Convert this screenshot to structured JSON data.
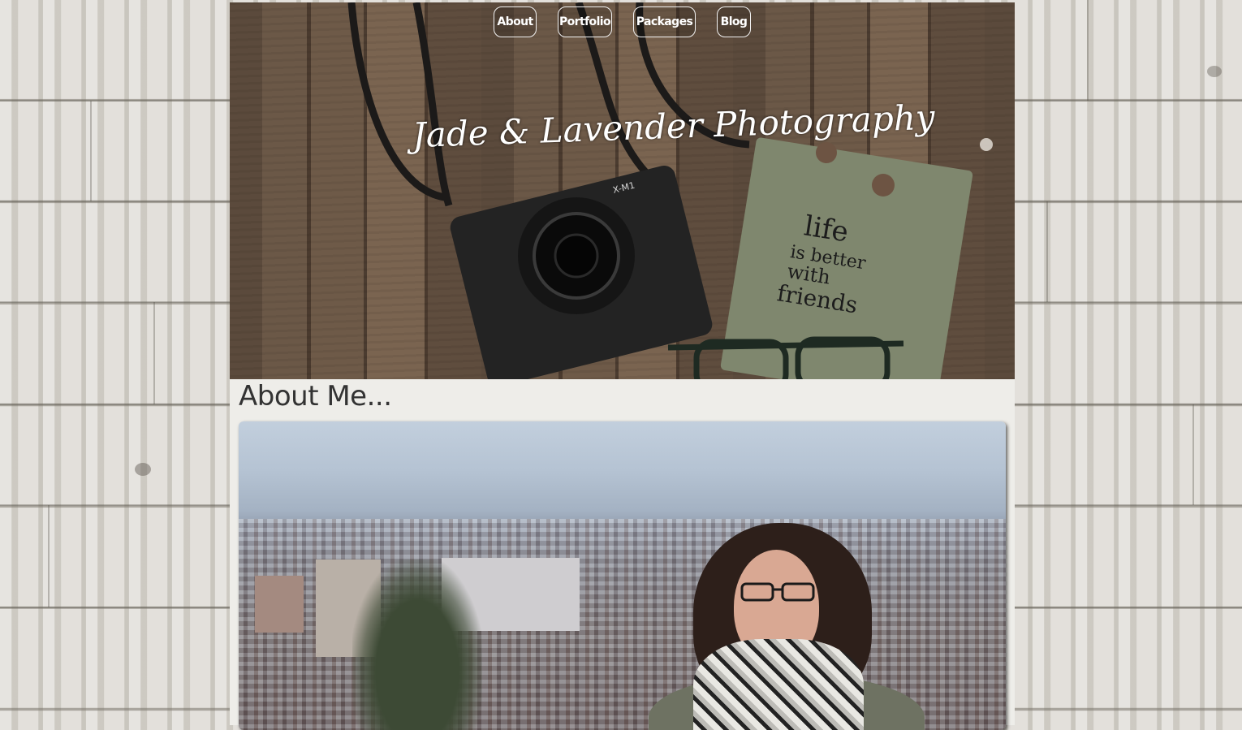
{
  "nav": {
    "items": [
      {
        "label": "About"
      },
      {
        "label": "Portfolio"
      },
      {
        "label": "Packages"
      },
      {
        "label": "Blog"
      }
    ]
  },
  "site": {
    "title": "Jade & Lavender Photography"
  },
  "hero": {
    "notebook_text": [
      "life",
      "is better",
      "with",
      "friends"
    ],
    "camera_model": "X-M1"
  },
  "about": {
    "heading": "About Me..."
  }
}
